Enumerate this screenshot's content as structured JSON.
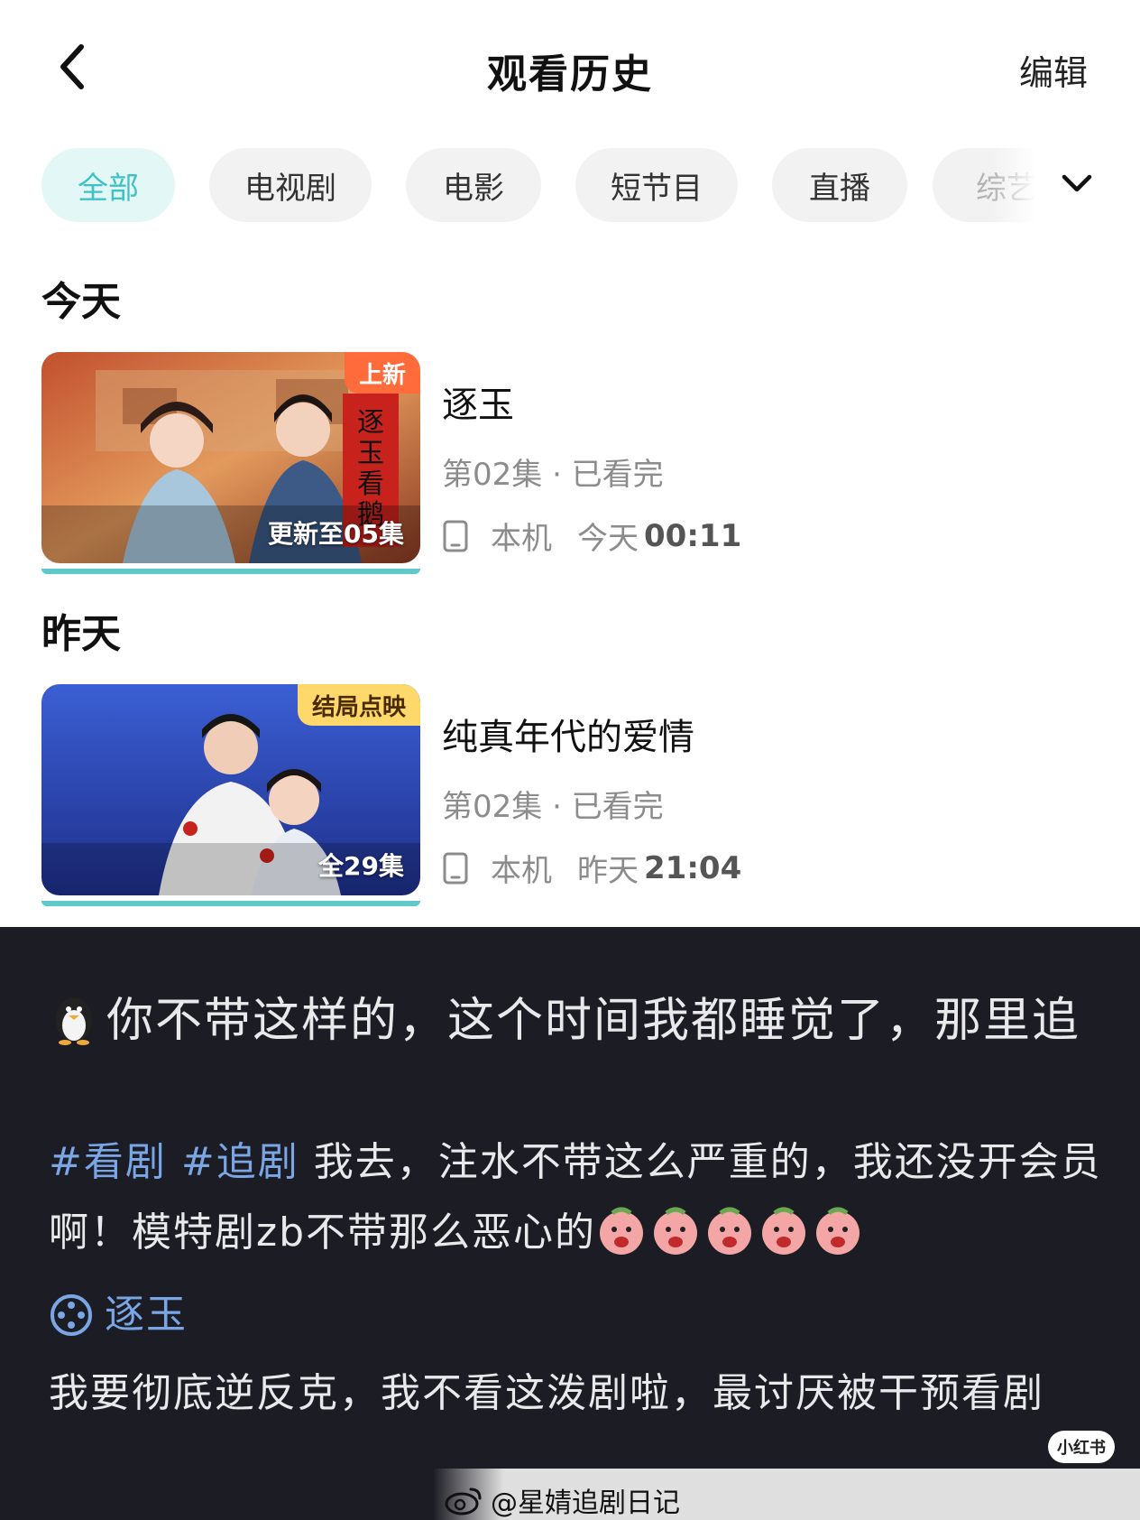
{
  "header": {
    "title": "观看历史",
    "edit_label": "编辑"
  },
  "filters": [
    {
      "label": "全部",
      "active": true
    },
    {
      "label": "电视剧",
      "active": false
    },
    {
      "label": "电影",
      "active": false
    },
    {
      "label": "短节目",
      "active": false
    },
    {
      "label": "直播",
      "active": false
    },
    {
      "label": "综艺",
      "active": false
    }
  ],
  "sections": [
    {
      "title": "今天",
      "items": [
        {
          "title": "逐玉",
          "badge": "上新",
          "episode_label": "更新至05集",
          "progress": "第02集 · 已看完",
          "device": "本机",
          "time_prefix": "今天",
          "time": "00:11",
          "poster_text": "逐玉看鹅"
        }
      ]
    },
    {
      "title": "昨天",
      "items": [
        {
          "title": "纯真年代的爱情",
          "badge": "结局点映",
          "episode_label": "全29集",
          "progress": "第02集 · 已看完",
          "device": "本机",
          "time_prefix": "昨天",
          "time": "21:04"
        }
      ]
    }
  ],
  "post": {
    "headline": "你不带这样的，这个时间我都睡觉了，那里追",
    "hashtags": [
      "#看剧",
      "#追剧"
    ],
    "body_1": "我去，注水不带这么严重的，我还没开会员啊！模特剧zb不带那么恶心的",
    "topic": "逐玉",
    "body_2": "我要彻底逆反克，我不看这泼剧啦，最讨厌被干预看剧",
    "xhs_badge": "小红书",
    "watermark": "@星婧追剧日记"
  },
  "colors": {
    "accent": "#3fc2c5",
    "active_chip_bg": "#e3f7f6",
    "post_bg": "#1c1c24",
    "hashtag": "#7aa6e6",
    "badge_orange": "#ff6b3a",
    "badge_yellow": "#ffd86b"
  }
}
